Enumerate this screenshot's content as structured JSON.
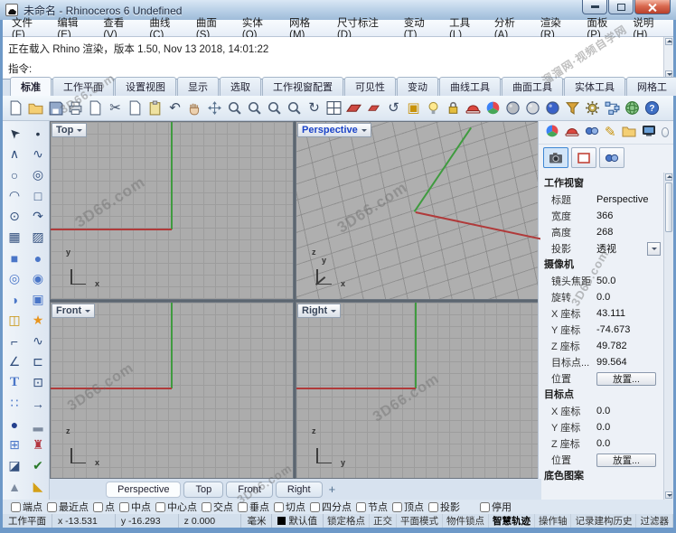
{
  "window": {
    "title": "未命名 - Rhinoceros 6 Undefined"
  },
  "menu": {
    "items": [
      "文件(F)",
      "编辑(E)",
      "查看(V)",
      "曲线(C)",
      "曲面(S)",
      "实体(O)",
      "网格(M)",
      "尺寸标注(D)",
      "变动(T)",
      "工具(L)",
      "分析(A)",
      "渲染(R)",
      "面板(P)",
      "说明(H)"
    ]
  },
  "command": {
    "history": "正在载入 Rhino 渲染，版本 1.50, Nov 13 2018, 14:01:22",
    "prompt": "指令:"
  },
  "toolbar": {
    "tabs": [
      "标准",
      "工作平面",
      "设置视图",
      "显示",
      "选取",
      "工作视窗配置",
      "可见性",
      "变动",
      "曲线工具",
      "曲面工具",
      "实体工具",
      "网格工"
    ],
    "active_tab": "标准",
    "overflow": "»",
    "icons": [
      {
        "name": "new-file-icon"
      },
      {
        "name": "open-file-icon"
      },
      {
        "name": "save-icon"
      },
      {
        "name": "print-icon"
      },
      {
        "name": "export-icon"
      },
      {
        "name": "cut-icon",
        "glyph": "✂"
      },
      {
        "name": "copy-icon"
      },
      {
        "name": "paste-icon"
      },
      {
        "name": "undo-icon",
        "glyph": "↶"
      },
      {
        "name": "pan-icon"
      },
      {
        "name": "move-icon"
      },
      {
        "name": "zoom-in-icon"
      },
      {
        "name": "zoom-window-icon"
      },
      {
        "name": "zoom-dynamic-icon"
      },
      {
        "name": "zoom-selected-icon"
      },
      {
        "name": "rotate-view-icon",
        "glyph": "↻"
      },
      {
        "name": "four-viewports-icon"
      },
      {
        "name": "cplane-icon"
      },
      {
        "name": "cplane-world-icon"
      },
      {
        "name": "undo-view-icon",
        "glyph": "↺"
      },
      {
        "name": "named-view-icon",
        "glyph": "▣"
      },
      {
        "name": "visibility-bulb-icon"
      },
      {
        "name": "lock-icon"
      },
      {
        "name": "display-mode-icon"
      },
      {
        "name": "color-wheel-icon"
      },
      {
        "name": "shaded-view-icon"
      },
      {
        "name": "xray-view-icon"
      },
      {
        "name": "rendered-view-icon"
      },
      {
        "name": "filter-icon"
      },
      {
        "name": "options-gear-icon"
      },
      {
        "name": "history-icon"
      },
      {
        "name": "render-globe-icon"
      },
      {
        "name": "help-icon"
      }
    ]
  },
  "left_toolbar": {
    "icons": [
      {
        "name": "select-arrow-icon",
        "glyph": "➤"
      },
      {
        "name": "point-icon",
        "glyph": "•"
      },
      {
        "name": "polyline-icon",
        "glyph": "∧"
      },
      {
        "name": "control-point-curve-icon",
        "glyph": "∿"
      },
      {
        "name": "circle-icon",
        "glyph": "○"
      },
      {
        "name": "ellipse-icon",
        "glyph": "◎"
      },
      {
        "name": "arc-icon",
        "glyph": "◠"
      },
      {
        "name": "rectangle-icon",
        "glyph": "□"
      },
      {
        "name": "point-cloud-icon",
        "glyph": "⊙"
      },
      {
        "name": "helix-icon",
        "glyph": "↷"
      },
      {
        "name": "surface-icon",
        "glyph": "▦"
      },
      {
        "name": "sweep-surface-icon",
        "glyph": "▨"
      },
      {
        "name": "box-icon",
        "glyph": "■"
      },
      {
        "name": "sphere-icon",
        "glyph": "●"
      },
      {
        "name": "torus-icon",
        "glyph": "◎"
      },
      {
        "name": "extrude-solid-icon",
        "glyph": "◉"
      },
      {
        "name": "cap-solid-icon",
        "glyph": "◑"
      },
      {
        "name": "solid-edit-icon",
        "glyph": "▣"
      },
      {
        "name": "boolean-union-icon",
        "glyph": "◫"
      },
      {
        "name": "explode-icon",
        "glyph": "★"
      },
      {
        "name": "fillet-corner-icon",
        "glyph": "⌐"
      },
      {
        "name": "blend-curve-icon",
        "glyph": "∿"
      },
      {
        "name": "chamfer-icon",
        "glyph": "∠"
      },
      {
        "name": "offset-icon",
        "glyph": "⊏"
      },
      {
        "name": "text-icon",
        "glyph": "T"
      },
      {
        "name": "edit-points-icon",
        "glyph": "⊡"
      },
      {
        "name": "array-icon",
        "glyph": "∷"
      },
      {
        "name": "extrude-icon",
        "glyph": "→"
      },
      {
        "name": "render-preview-icon",
        "glyph": "●"
      },
      {
        "name": "ground-plane-icon",
        "glyph": "▂"
      },
      {
        "name": "block-grid-icon",
        "glyph": "⊞"
      },
      {
        "name": "spotlight-icon",
        "glyph": "♜"
      },
      {
        "name": "copy-objects-icon",
        "glyph": "◪"
      },
      {
        "name": "select-check-icon",
        "glyph": "✔"
      },
      {
        "name": "cone-icon",
        "glyph": "▲"
      },
      {
        "name": "material-gold-icon",
        "glyph": "◣"
      }
    ]
  },
  "viewports": {
    "items": [
      {
        "label": "Top",
        "axes": [
          "y",
          "x"
        ]
      },
      {
        "label": "Perspective",
        "axes": [
          "z",
          "y",
          "x"
        ],
        "active": true
      },
      {
        "label": "Front",
        "axes": [
          "z",
          "x"
        ]
      },
      {
        "label": "Right",
        "axes": [
          "z",
          "y"
        ]
      }
    ]
  },
  "panel": {
    "tabs": [
      {
        "name": "properties-tab-icon"
      },
      {
        "name": "display-tab-icon"
      },
      {
        "name": "viewport-tab-icon"
      },
      {
        "name": "notes-tab-icon",
        "glyph": "✎"
      },
      {
        "name": "files-tab-icon"
      },
      {
        "name": "monitor-tab-icon"
      }
    ],
    "view_buttons": [
      {
        "name": "camera-view-button",
        "active": true
      },
      {
        "name": "wallpaper-button"
      },
      {
        "name": "walkabout-button"
      }
    ],
    "sections": [
      {
        "title": "工作视窗",
        "rows": [
          {
            "label": "标题",
            "value": "Perspective"
          },
          {
            "label": "宽度",
            "value": "366"
          },
          {
            "label": "高度",
            "value": "268"
          },
          {
            "label": "投影",
            "value": "透视"
          }
        ]
      },
      {
        "title": "摄像机",
        "rows": [
          {
            "label": "镜头焦距",
            "value": "50.0"
          },
          {
            "label": "旋转",
            "value": "0.0"
          },
          {
            "label": "X 座标",
            "value": "43.111"
          },
          {
            "label": "Y 座标",
            "value": "-74.673"
          },
          {
            "label": "Z 座标",
            "value": "49.782"
          },
          {
            "label": "目标点...",
            "value": "99.564"
          },
          {
            "label": "位置",
            "value": "放置..."
          }
        ]
      },
      {
        "title": "目标点",
        "rows": [
          {
            "label": "X 座标",
            "value": "0.0"
          },
          {
            "label": "Y 座标",
            "value": "0.0"
          },
          {
            "label": "Z 座标",
            "value": "0.0"
          },
          {
            "label": "位置",
            "value": "放置..."
          }
        ]
      },
      {
        "title": "底色图案",
        "rows": []
      }
    ]
  },
  "viewport_tabs": {
    "tabs": [
      "Perspective",
      "Top",
      "Front",
      "Right"
    ],
    "active": "Perspective",
    "add": "+"
  },
  "osnap": {
    "items": [
      "端点",
      "最近点",
      "点",
      "中点",
      "中心点",
      "交点",
      "垂点",
      "切点",
      "四分点",
      "节点",
      "顶点",
      "投影"
    ],
    "disable_label": "停用"
  },
  "statusbar": {
    "cplane": "工作平面",
    "coords": {
      "x": "x -13.531",
      "y": "y -16.293",
      "z": "z 0.000"
    },
    "units": "毫米",
    "layer": "默认值",
    "toggles": [
      "锁定格点",
      "正交",
      "平面模式",
      "物件锁点",
      "智慧轨迹",
      "操作轴",
      "记录建构历史",
      "过滤器"
    ],
    "active_toggle": "智慧轨迹"
  },
  "watermarks": {
    "brand": "3D66.com",
    "site": "溜溜网·视频自学网"
  },
  "colors": {
    "titlebar": "#b7cfe6",
    "viewport_bg": "#acacac",
    "grid": "#9d9d9d",
    "axis_green": "#3f9b3f",
    "axis_red": "#b03a3a",
    "active_label": "#1a43c8"
  }
}
